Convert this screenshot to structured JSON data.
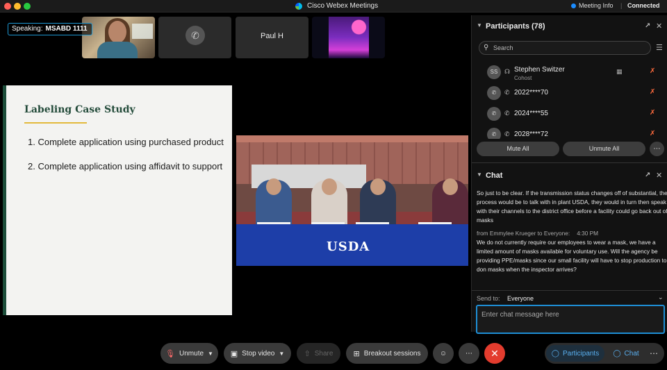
{
  "window": {
    "title": "Cisco Webex Meetings",
    "meeting_info": "Meeting Info",
    "separator": "|",
    "status": "Connected"
  },
  "speaking": {
    "label": "Speaking:",
    "name": "MSABD 1111"
  },
  "thumbnails": {
    "name_paul": "Paul H"
  },
  "slide": {
    "title": "Labeling Case Study",
    "items": [
      "1. Complete application using purchased product",
      "2. Complete application using affidavit to support"
    ]
  },
  "video": {
    "banner": "USDA"
  },
  "toolbar": {
    "unmute": "Unmute",
    "stop_video": "Stop video",
    "share": "Share",
    "breakout": "Breakout sessions",
    "participants": "Participants",
    "chat": "Chat"
  },
  "participants_panel": {
    "title": "Participants (78)",
    "search_placeholder": "Search",
    "rows": [
      {
        "initials": "SS",
        "name": "Stephen Switzer",
        "role": "Cohost"
      },
      {
        "initials": "",
        "name": "2022****70",
        "role": ""
      },
      {
        "initials": "",
        "name": "2024****55",
        "role": ""
      },
      {
        "initials": "",
        "name": "2028****72",
        "role": ""
      }
    ],
    "mute_all": "Mute All",
    "unmute_all": "Unmute All"
  },
  "chat_panel": {
    "title": "Chat",
    "messages": [
      {
        "text": "So just to be clear. If the transmission status changes off of substantial, the process would be to talk with in plant USDA, they would in turn then speak with their channels to the district office before a facility could go back out of masks"
      },
      {
        "from": "from Emmylee Krueger to Everyone:",
        "time": "4:30 PM",
        "text": "We do not currently require our employees to wear a mask, we have a limited amount of masks available for voluntary use. Will the agency be providing PPE/masks since our small facility will have to stop production to don masks when the inspector arrives?"
      }
    ],
    "send_to_label": "Send to:",
    "send_to_value": "Everyone",
    "input_placeholder": "Enter chat message here"
  },
  "icons": {
    "mic_muted": "mic-off-icon",
    "video": "camera-icon",
    "share": "share-icon",
    "breakout": "grid-icon",
    "reaction": "smile-icon",
    "more": "ellipsis-icon",
    "leave": "x-icon",
    "phone": "phone-icon",
    "headset": "headset-icon"
  },
  "colors": {
    "leave": "#e33c2e",
    "accent": "#1e8fd6",
    "mute_red": "#ff6b3d",
    "slide_title": "#234b3a",
    "slide_underline": "#e2b93b"
  }
}
